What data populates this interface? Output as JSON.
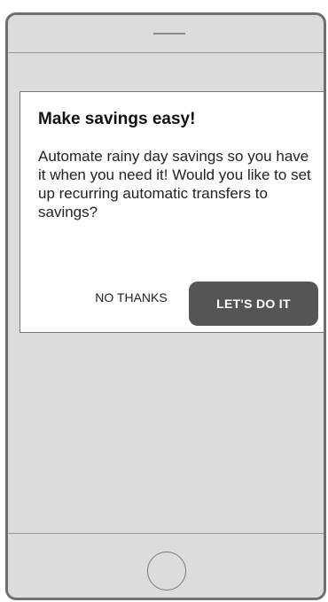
{
  "dialog": {
    "title": "Make savings easy!",
    "body": "Automate rainy day savings so you have it when you need it! Would you like to set up recurring automatic transfers to savings?",
    "secondary_label": "NO THANKS",
    "primary_label": "LET'S DO IT"
  },
  "colors": {
    "phone_body": "#dcdcdc",
    "phone_frame": "#6f6f6f",
    "primary_button": "#555555"
  }
}
